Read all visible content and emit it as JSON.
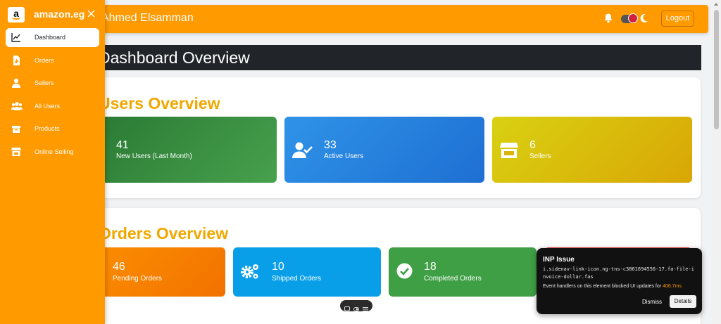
{
  "topbar": {
    "username": "Ahmed Elsamman",
    "logout_label": "Logout"
  },
  "page": {
    "title": "Dashboard Overview"
  },
  "users_section": {
    "title": "Users Overview",
    "cards": [
      {
        "value": "41",
        "label": "New Users (Last Month)"
      },
      {
        "value": "33",
        "label": "Active Users"
      },
      {
        "value": "6",
        "label": "Sellers"
      }
    ]
  },
  "orders_section": {
    "title": "Orders Overview",
    "cards": [
      {
        "value": "46",
        "label": "Pending Orders"
      },
      {
        "value": "10",
        "label": "Shipped Orders"
      },
      {
        "value": "18",
        "label": "Completed Orders"
      }
    ]
  },
  "sidebar": {
    "logo_letter": "a",
    "brand": "amazon.eg",
    "items": [
      {
        "label": "Dashboard",
        "icon": "chart-line-icon"
      },
      {
        "label": "Orders",
        "icon": "invoice-dollar-icon"
      },
      {
        "label": "Sellers",
        "icon": "user-tie-icon"
      },
      {
        "label": "All Users",
        "icon": "users-icon"
      },
      {
        "label": "Products",
        "icon": "boxes-icon"
      },
      {
        "label": "Online Selling",
        "icon": "store-icon"
      }
    ]
  },
  "inp_popup": {
    "title": "INP Issue",
    "selector": "i.sidenav-link-icon.ng-tns-c3861694556-17.fa-file-invoice-dollar.fas",
    "description": "Event handlers on this element blocked UI updates for",
    "duration": "406.7ms",
    "dismiss_label": "Dismiss",
    "details_label": "Details"
  },
  "colors": {
    "brand": "#ff9a00",
    "header_dark": "#212529",
    "section_title": "#f0a800"
  }
}
